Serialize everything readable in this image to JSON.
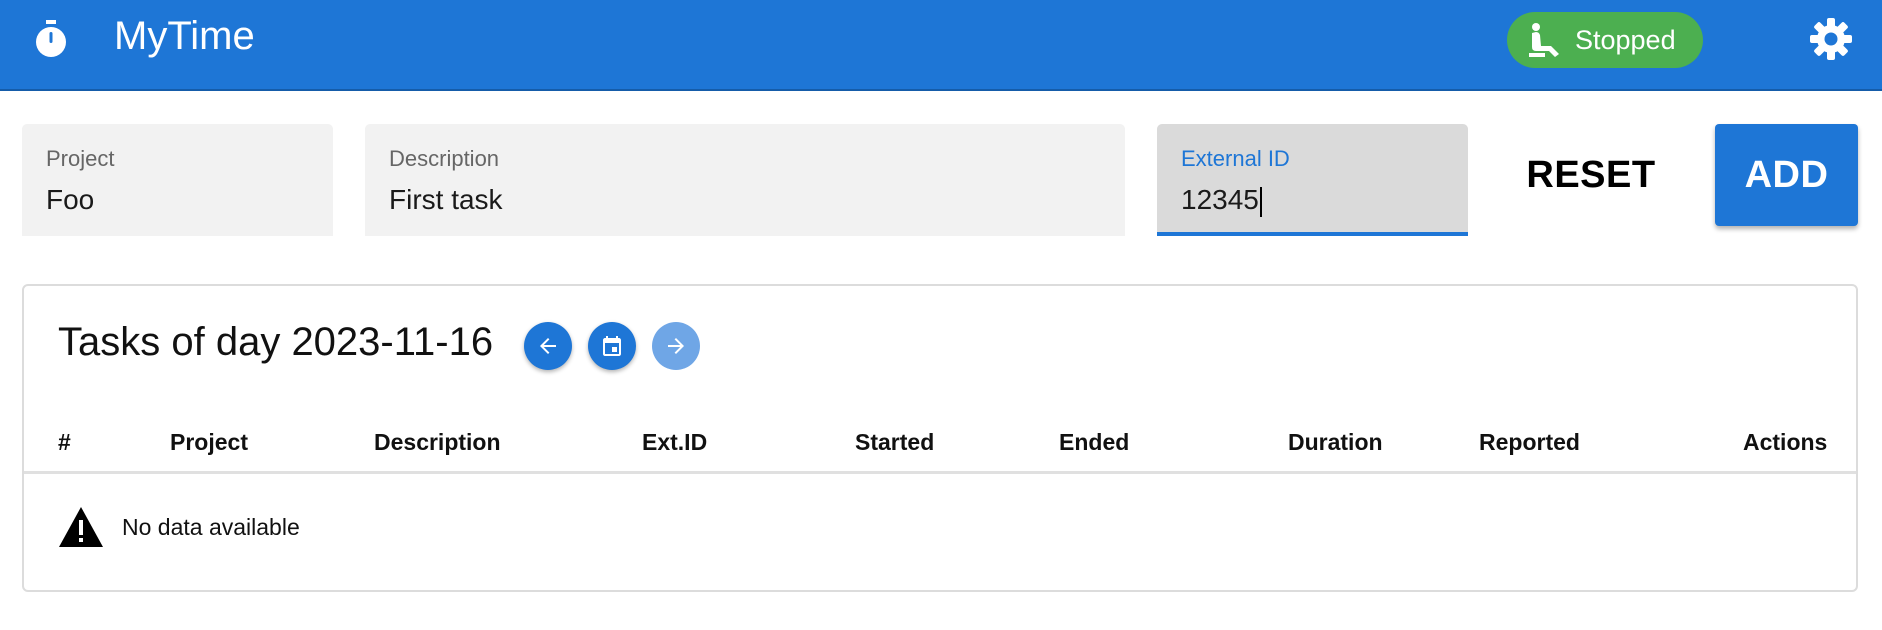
{
  "header": {
    "app_icon": "stopwatch-icon",
    "title": "MyTime",
    "status": {
      "label": "Stopped",
      "icon": "seat-icon",
      "color": "#4caf50"
    },
    "settings_icon": "gear-icon",
    "color": "#1e76d6"
  },
  "form": {
    "project": {
      "label": "Project",
      "value": "Foo"
    },
    "description": {
      "label": "Description",
      "value": "First task"
    },
    "external_id": {
      "label": "External ID",
      "value": "12345"
    },
    "reset_label": "RESET",
    "add_label": "ADD"
  },
  "tasks": {
    "title": "Tasks of day 2023-11-16",
    "nav": {
      "prev_icon": "arrow-left-icon",
      "today_icon": "calendar-icon",
      "next_icon": "arrow-right-icon"
    },
    "columns": [
      "#",
      "Project",
      "Description",
      "Ext.ID",
      "Started",
      "Ended",
      "Duration",
      "Reported",
      "Actions"
    ],
    "rows": [],
    "empty_text": "No data available",
    "empty_icon": "warning-icon"
  }
}
